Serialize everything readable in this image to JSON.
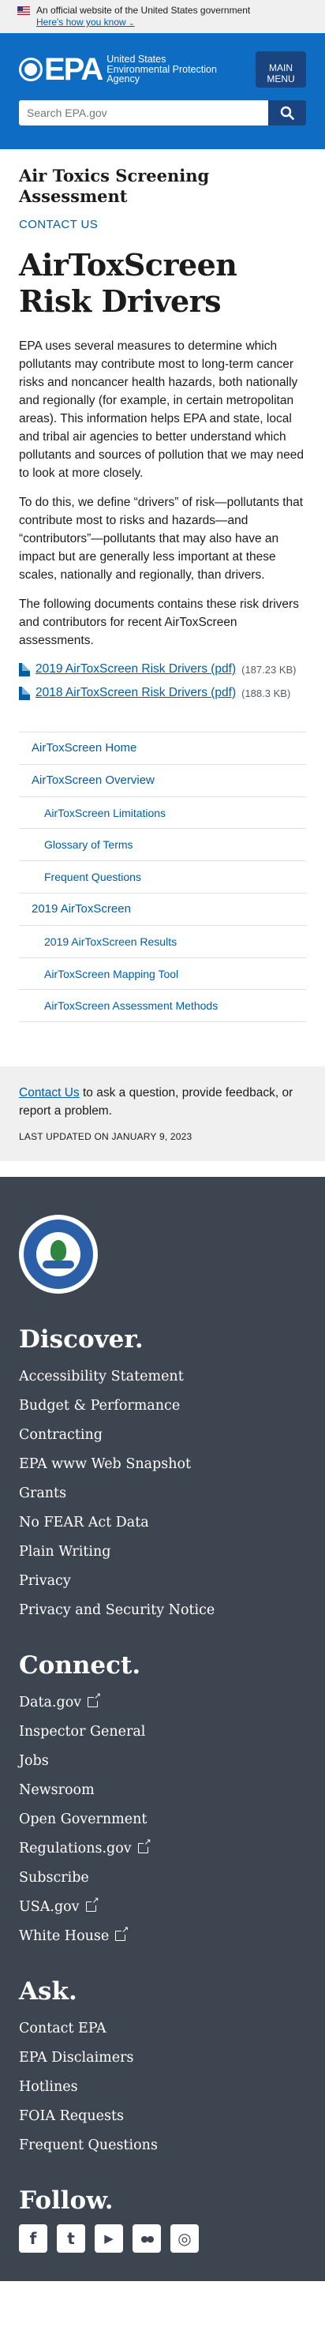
{
  "gov_banner": {
    "text": "An official website of the United States government",
    "how_link": "Here's how you know",
    "chevron": "⌄"
  },
  "header": {
    "logo_text": "EPA",
    "logo_subtext": "United States Environmental Protection Agency",
    "menu_line1": "MAIN",
    "menu_line2": "MENU",
    "search_placeholder": "Search EPA.gov",
    "search_icon": "search-icon"
  },
  "main": {
    "collection_title": "Air Toxics Screening Assessment",
    "contact_us": "CONTACT US",
    "title": "AirToxScreen Risk Drivers",
    "paragraphs": [
      "EPA uses several measures to determine which pollutants may contribute most to long-term cancer risks and noncancer health hazards, both nationally and regionally (for example, in certain metropolitan areas). This information helps EPA and state, local and tribal air agencies to better understand which pollutants and sources of pollution that we may need to look at more closely.",
      "To do this, we define “drivers” of risk—pollutants that contribute most to risks and hazards—and “contributors”—pollutants that may also have an impact but are generally less important at these scales, nationally and regionally, than drivers.",
      "The following documents contains these risk drivers and contributors for recent AirToxScreen assessments."
    ],
    "documents": [
      {
        "label": "2019 AirToxScreen Risk Drivers (pdf)",
        "size": "(187.23 KB)"
      },
      {
        "label": "2018 AirToxScreen Risk Drivers (pdf)",
        "size": "(188.3 KB)"
      }
    ]
  },
  "sidenav": [
    {
      "label": "AirToxScreen Home",
      "level": 1
    },
    {
      "label": "AirToxScreen Overview",
      "level": 1
    },
    {
      "label": "AirToxScreen Limitations",
      "level": 2
    },
    {
      "label": "Glossary of Terms",
      "level": 2
    },
    {
      "label": "Frequent Questions",
      "level": 2
    },
    {
      "label": "2019 AirToxScreen",
      "level": 1
    },
    {
      "label": "2019 AirToxScreen Results",
      "level": 2
    },
    {
      "label": "AirToxScreen Mapping Tool",
      "level": 2
    },
    {
      "label": "AirToxScreen Assessment Methods",
      "level": 2
    }
  ],
  "contact_band": {
    "link": "Contact Us",
    "text": " to ask a question, provide feedback, or report a problem.",
    "last_updated": "LAST UPDATED ON JANUARY 9, 2023"
  },
  "footer": {
    "seal_label": "UNITED STATES ENVIRONMENTAL PROTECTION AGENCY",
    "discover": {
      "heading": "Discover.",
      "links": [
        "Accessibility Statement",
        "Budget & Performance",
        "Contracting",
        "EPA www Web Snapshot",
        "Grants",
        "No FEAR Act Data",
        "Plain Writing",
        "Privacy",
        "Privacy and Security Notice"
      ]
    },
    "connect": {
      "heading": "Connect.",
      "links": [
        {
          "label": "Data.gov",
          "external": true
        },
        {
          "label": "Inspector General",
          "external": false
        },
        {
          "label": "Jobs",
          "external": false
        },
        {
          "label": "Newsroom",
          "external": false
        },
        {
          "label": "Open Government",
          "external": false
        },
        {
          "label": "Regulations.gov",
          "external": true
        },
        {
          "label": "Subscribe",
          "external": false
        },
        {
          "label": "USA.gov",
          "external": true
        },
        {
          "label": "White House",
          "external": true
        }
      ]
    },
    "ask": {
      "heading": "Ask.",
      "links": [
        "Contact EPA",
        "EPA Disclaimers",
        "Hotlines",
        "FOIA Requests",
        "Frequent Questions"
      ]
    },
    "follow": {
      "heading": "Follow.",
      "icons": [
        {
          "name": "facebook-icon",
          "glyph": "f"
        },
        {
          "name": "twitter-icon",
          "glyph": "t"
        },
        {
          "name": "youtube-icon",
          "glyph": "▶"
        },
        {
          "name": "flickr-icon",
          "glyph": "●●"
        },
        {
          "name": "instagram-icon",
          "glyph": "◎"
        }
      ]
    }
  },
  "colors": {
    "header_blue": "#0e6cc2",
    "navy": "#1a4480",
    "link": "#005ea2",
    "footer_bg": "#3d4551",
    "band_bg": "#f0f0f0"
  }
}
